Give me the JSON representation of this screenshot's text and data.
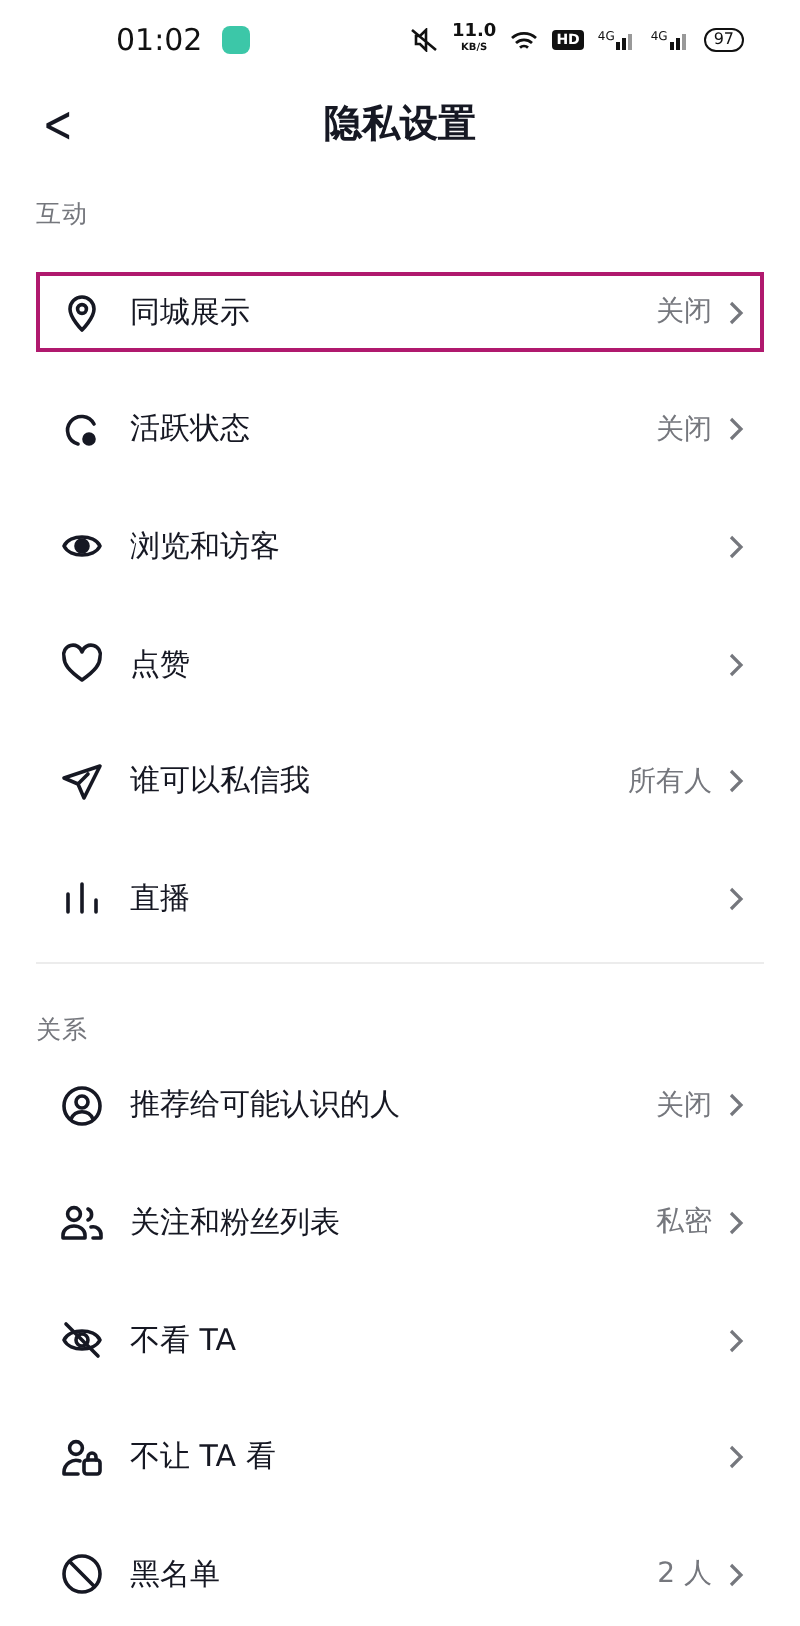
{
  "status_bar": {
    "time": "01:02",
    "net_speed": "11.0",
    "net_unit": "KB/S",
    "hd": "HD",
    "signal_1": "4G",
    "signal_2": "4G",
    "battery": "97"
  },
  "header": {
    "back": "<",
    "title": "隐私设置"
  },
  "sections": [
    {
      "title": "互动",
      "items": [
        {
          "kind": "pin",
          "label": "同城展示",
          "value": "关闭",
          "highlighted": true
        },
        {
          "kind": "active",
          "label": "活跃状态",
          "value": "关闭",
          "highlighted": false
        },
        {
          "kind": "eye",
          "label": "浏览和访客",
          "highlighted": false
        },
        {
          "kind": "heart",
          "label": "点赞",
          "highlighted": false
        },
        {
          "kind": "send",
          "label": "谁可以私信我",
          "value": "所有人",
          "highlighted": false
        },
        {
          "kind": "bars",
          "label": "直播",
          "highlighted": false
        }
      ]
    },
    {
      "title": "关系",
      "items": [
        {
          "kind": "person",
          "label": "推荐给可能认识的人",
          "value": "关闭",
          "highlighted": false
        },
        {
          "kind": "people",
          "label": "关注和粉丝列表",
          "value": "私密",
          "highlighted": false
        },
        {
          "kind": "eyeoff",
          "label": "不看 TA",
          "highlighted": false
        },
        {
          "kind": "personlock",
          "label": "不让 TA 看",
          "highlighted": false
        },
        {
          "kind": "block",
          "label": "黑名单",
          "value": "2 人",
          "highlighted": false
        }
      ]
    }
  ]
}
